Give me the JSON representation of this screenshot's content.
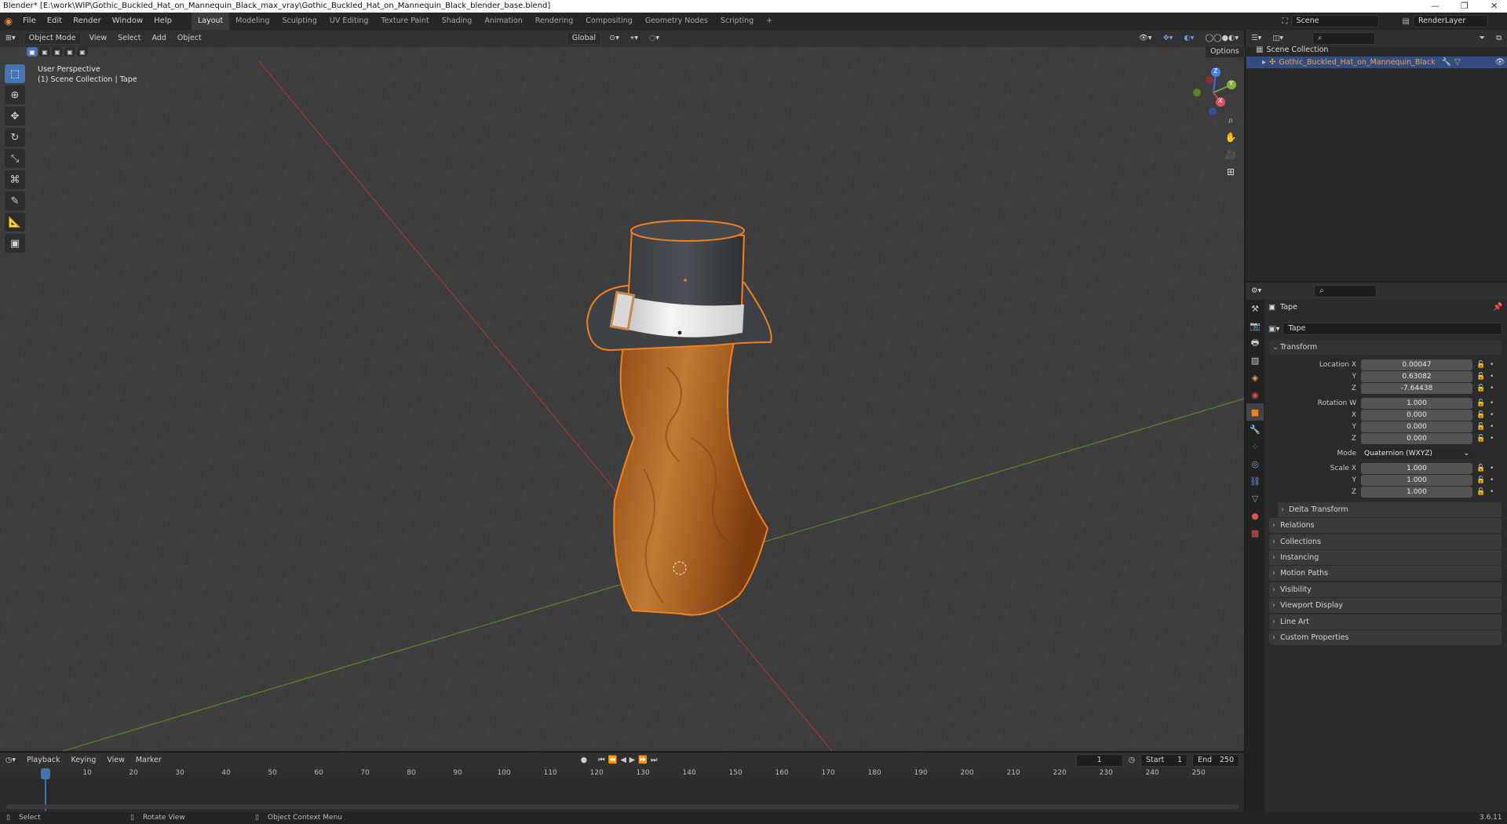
{
  "window": {
    "title": "Blender* [E:\\work\\WIP\\Gothic_Buckled_Hat_on_Mannequin_Black_max_vray\\Gothic_Buckled_Hat_on_Mannequin_Black_blender_base.blend]",
    "controls": [
      "—",
      "❐",
      "✕"
    ]
  },
  "menu": {
    "items": [
      "File",
      "Edit",
      "Render",
      "Window",
      "Help"
    ],
    "workspaces": [
      "Layout",
      "Modeling",
      "Sculpting",
      "UV Editing",
      "Texture Paint",
      "Shading",
      "Animation",
      "Rendering",
      "Compositing",
      "Geometry Nodes",
      "Scripting"
    ],
    "active_workspace": "Layout",
    "add_tab": "+",
    "scene": "Scene",
    "render_layer": "RenderLayer"
  },
  "viewport": {
    "mode": "Object Mode",
    "header_menus": [
      "View",
      "Select",
      "Add",
      "Object"
    ],
    "orientation": "Global",
    "options": "Options",
    "perspective": "User Perspective",
    "collection_info": "(1) Scene Collection | Tape",
    "gizmo_axes": [
      "X",
      "Y",
      "Z"
    ]
  },
  "outliner": {
    "root": "Scene Collection",
    "object": "Gothic_Buckled_Hat_on_Mannequin_Black"
  },
  "properties": {
    "object_name": "Tape",
    "data_name": "Tape",
    "transform_header": "Transform",
    "location_label": "Location X",
    "location": {
      "x": "0.00047",
      "y": "0.63082",
      "z": "-7.64438"
    },
    "rotation_label": "Rotation W",
    "rotation": {
      "w": "1.000",
      "x": "0.000",
      "y": "0.000",
      "z": "0.000"
    },
    "mode_label": "Mode",
    "mode_value": "Quaternion (WXYZ)",
    "scale_label": "Scale X",
    "scale": {
      "x": "1.000",
      "y": "1.000",
      "z": "1.000"
    },
    "axis_labels": {
      "x": "X",
      "y": "Y",
      "z": "Z"
    },
    "delta_transform": "Delta Transform",
    "panels": [
      "Relations",
      "Collections",
      "Instancing",
      "Motion Paths",
      "Visibility",
      "Viewport Display",
      "Line Art",
      "Custom Properties"
    ]
  },
  "timeline": {
    "menus": [
      "Playback",
      "Keying",
      "View",
      "Marker"
    ],
    "current_frame": "1",
    "start_label": "Start",
    "start": "1",
    "end_label": "End",
    "end": "250",
    "ruler_ticks": [
      "1",
      "10",
      "20",
      "30",
      "40",
      "50",
      "60",
      "70",
      "80",
      "90",
      "100",
      "110",
      "120",
      "130",
      "140",
      "150",
      "160",
      "170",
      "180",
      "190",
      "200",
      "210",
      "220",
      "230",
      "240",
      "250"
    ]
  },
  "statusbar": {
    "select": "Select",
    "rotate": "Rotate View",
    "context_menu": "Object Context Menu",
    "version": "3.6.11"
  },
  "colors": {
    "accent": "#4772b3",
    "selection_orange": "#f08020",
    "viewport_bg": "#3d3d3d",
    "x_axis": "#c0393b",
    "y_axis": "#6a9a2c"
  },
  "icons": [
    "blender-logo-icon",
    "select-box-icon",
    "cursor-icon",
    "move-icon",
    "rotate-icon",
    "scale-icon",
    "transform-icon",
    "annotate-icon",
    "measure-icon",
    "add-cube-icon",
    "zoom-icon",
    "hand-icon",
    "camera-icon",
    "grid-icon",
    "eye-icon",
    "camera-render-icon",
    "search-icon",
    "filter-icon",
    "pin-icon",
    "play-icon"
  ]
}
